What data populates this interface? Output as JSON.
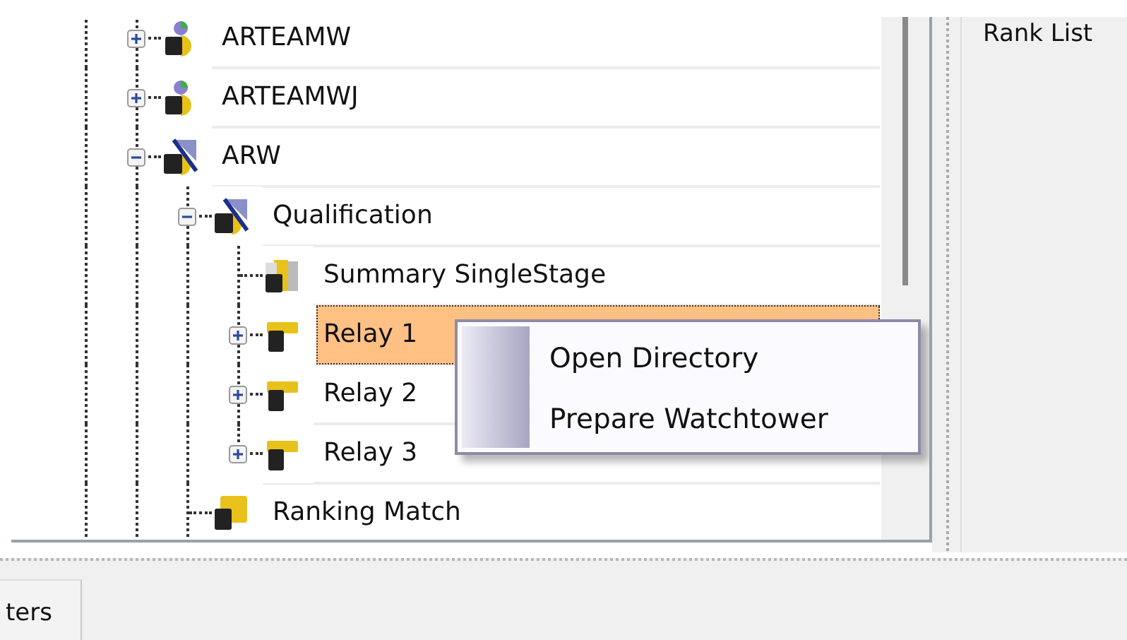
{
  "tree": [
    {
      "label": "ARTEAMW",
      "kind": "team",
      "expanded": false,
      "selected": false
    },
    {
      "label": "ARTEAMWJ",
      "kind": "team",
      "expanded": false,
      "selected": false
    },
    {
      "label": "ARW",
      "kind": "discipline",
      "expanded": true,
      "selected": false,
      "children": [
        {
          "label": "Qualification",
          "kind": "discipline",
          "expanded": true,
          "selected": false,
          "children": [
            {
              "label": "Summary SingleStage",
              "kind": "summary",
              "selected": false
            },
            {
              "label": "Relay 1",
              "kind": "relay",
              "expanded": false,
              "selected": true
            },
            {
              "label": "Relay 2",
              "kind": "relay",
              "expanded": false,
              "selected": false
            },
            {
              "label": "Relay 3",
              "kind": "relay",
              "expanded": false,
              "selected": false
            }
          ]
        },
        {
          "label": "Ranking Match",
          "kind": "match",
          "selected": false
        }
      ]
    }
  ],
  "context_menu": {
    "items": [
      {
        "label": "Open Directory"
      },
      {
        "label": "Prepare Watchtower"
      }
    ]
  },
  "side_panel": {
    "title": "Rank List"
  },
  "bottom_tabs": [
    {
      "label": "ters"
    }
  ]
}
